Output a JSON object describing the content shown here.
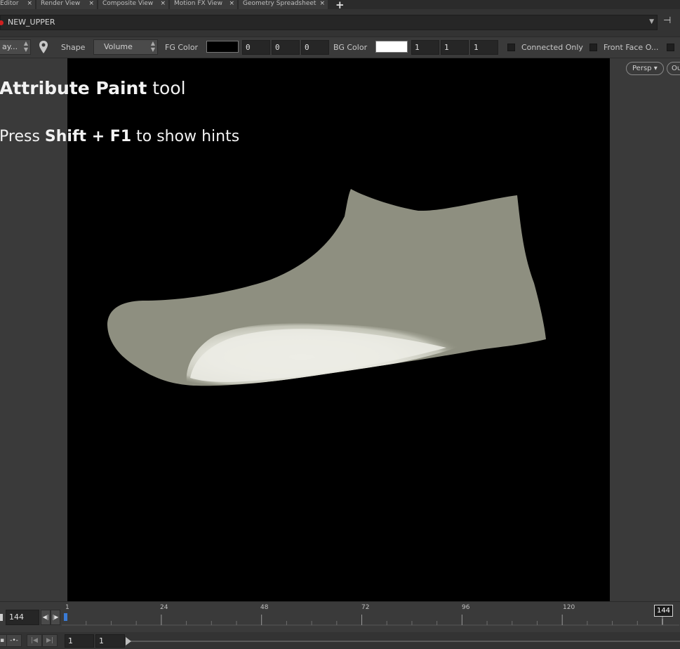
{
  "tabs": [
    {
      "label": "Editor"
    },
    {
      "label": "Render View"
    },
    {
      "label": "Composite View"
    },
    {
      "label": "Motion FX View"
    },
    {
      "label": "Geometry Spreadsheet"
    }
  ],
  "tab_close_glyph": "×",
  "tab_add_glyph": "+",
  "path": {
    "value": "NEW_UPPER",
    "dropdown_glyph": "▼",
    "pin_glyph": "⊣"
  },
  "toolbar": {
    "mode_select": "ay...",
    "shape_label": "Shape",
    "shape_value": "Volume",
    "fg_label": "FG Color",
    "fg_color": "#000000",
    "fg_values": [
      "0",
      "0",
      "0"
    ],
    "bg_label": "BG Color",
    "bg_color": "#ffffff",
    "bg_values": [
      "1",
      "1",
      "1"
    ],
    "connected_only": "Connected Only",
    "front_face": "Front Face O..."
  },
  "viewport": {
    "camera_menu": "Persp",
    "camera_caret": "▾",
    "second_menu": "Ou",
    "hint_title_bold": "Attribute Paint",
    "hint_title_rest": " tool",
    "hint_sub_pre": "Press ",
    "hint_sub_bold": "Shift + F1",
    "hint_sub_post": " to show hints",
    "mesh_color": "#8e8f80",
    "paint_color": "#e8e8e0"
  },
  "timeline": {
    "current_frame": "144",
    "tick_labels": [
      "1",
      "24",
      "48",
      "72",
      "96",
      "120"
    ],
    "marker": "144",
    "step_back": "◀|",
    "step_fwd": "|▶"
  },
  "bottom": {
    "start": "1",
    "end": "1",
    "btn_prev": "|◀",
    "btn_next": "▶|"
  }
}
